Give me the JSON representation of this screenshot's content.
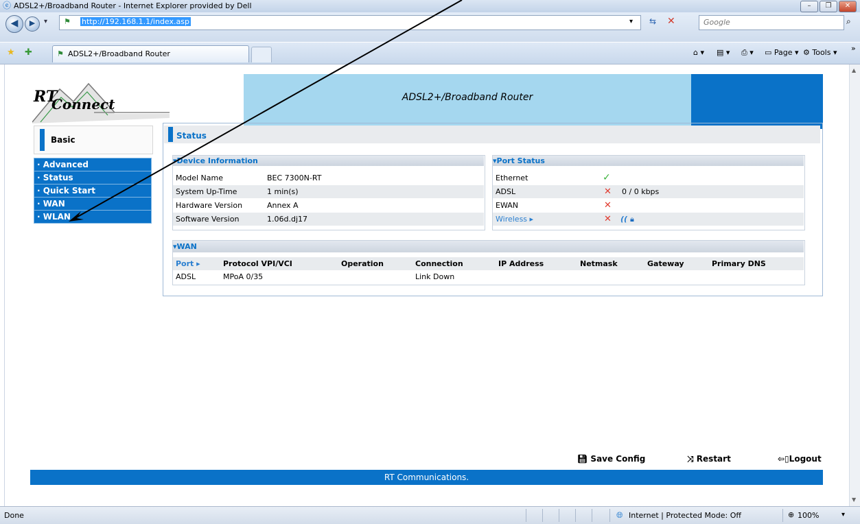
{
  "browser": {
    "window_title": "ADSL2+/Broadband Router - Internet Explorer provided by Dell",
    "url": "http://192.168.1.1/index.asp",
    "search_placeholder": "Google",
    "tab_title": "ADSL2+/Broadband Router",
    "commands": {
      "page": "Page ▾",
      "tools": "Tools ▾"
    },
    "status_text": "Done",
    "zone": "Internet | Protected Mode: Off",
    "zoom": "100%"
  },
  "router": {
    "logo_line1": "RT",
    "logo_line2": "Connect",
    "banner_title": "ADSL2+/Broadband Router",
    "basic_label": "Basic",
    "menu": [
      "· Advanced",
      "· Status",
      "· Quick Start",
      "· WAN",
      "· WLAN"
    ],
    "section_title": "Status",
    "device_info": {
      "title": "▾Device Information",
      "rows": [
        {
          "label": "Model Name",
          "value": "BEC 7300N-RT"
        },
        {
          "label": "System Up-Time",
          "value": "1 min(s)"
        },
        {
          "label": "Hardware Version",
          "value": "Annex A"
        },
        {
          "label": "Software Version",
          "value": "1.06d.dj17"
        }
      ]
    },
    "port_status": {
      "title": "▾Port Status",
      "rows": [
        {
          "label": "Ethernet",
          "mark": "✓",
          "value": ""
        },
        {
          "label": "ADSL",
          "mark": "✕",
          "value": "0 / 0 kbps"
        },
        {
          "label": "EWAN",
          "mark": "✕",
          "value": ""
        },
        {
          "label": "Wireless ▸",
          "mark": "✕",
          "value": ""
        }
      ]
    },
    "wan": {
      "title": "▾WAN",
      "headers": [
        "Port ▸",
        "Protocol VPI/VCI",
        "Operation",
        "Connection",
        "IP Address",
        "Netmask",
        "Gateway",
        "Primary DNS"
      ],
      "row": [
        "ADSL",
        "MPoA 0/35",
        "",
        "Link Down",
        "",
        "",
        "",
        ""
      ]
    },
    "footer_buttons": {
      "save": "Save Config",
      "restart": "Restart",
      "logout": "Logout"
    },
    "footer_text": "RT Communications."
  },
  "colors": {
    "accent": "#0a72c8",
    "banner": "#a5d7ef"
  }
}
